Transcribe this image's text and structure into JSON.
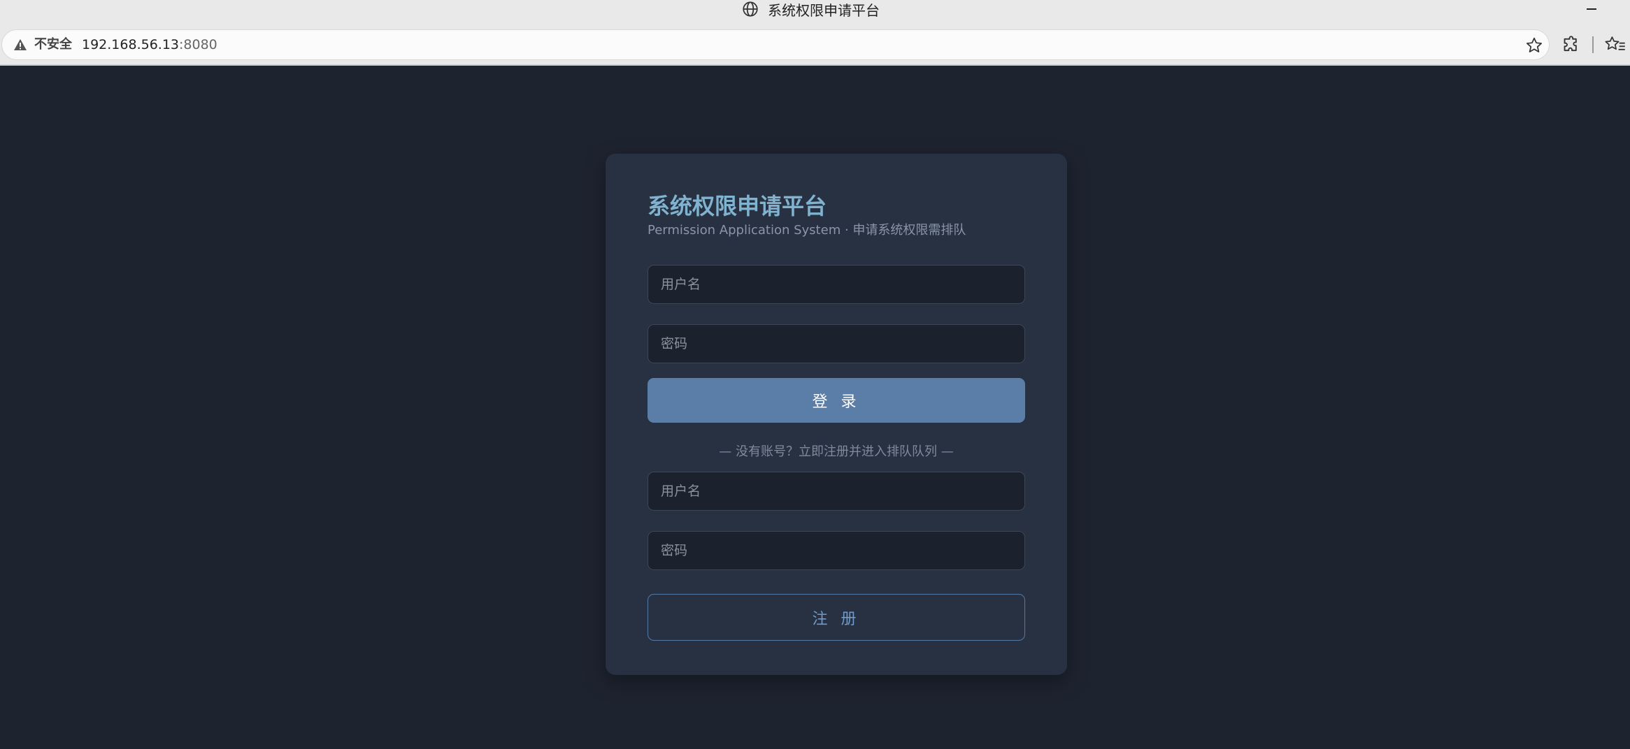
{
  "browser": {
    "window_title": "系统权限申请平台",
    "security_label": "不安全",
    "url_host": "192.168.56.13",
    "url_port": ":8080"
  },
  "card": {
    "title": "系统权限申请平台",
    "subtitle": "Permission Application System · 申请系统权限需排队"
  },
  "login": {
    "username_placeholder": "用户名",
    "password_placeholder": "密码",
    "button_label": "登 录"
  },
  "divider": "— 没有账号？立即注册并进入排队队列 —",
  "register": {
    "username_placeholder": "用户名",
    "password_placeholder": "密码",
    "button_label": "注 册"
  },
  "colors": {
    "page_bg": "#1e2330",
    "card_bg": "#283142",
    "title": "#7fb3cf",
    "primary_button": "#5b7ea8",
    "outline_button": "#5479a3"
  }
}
